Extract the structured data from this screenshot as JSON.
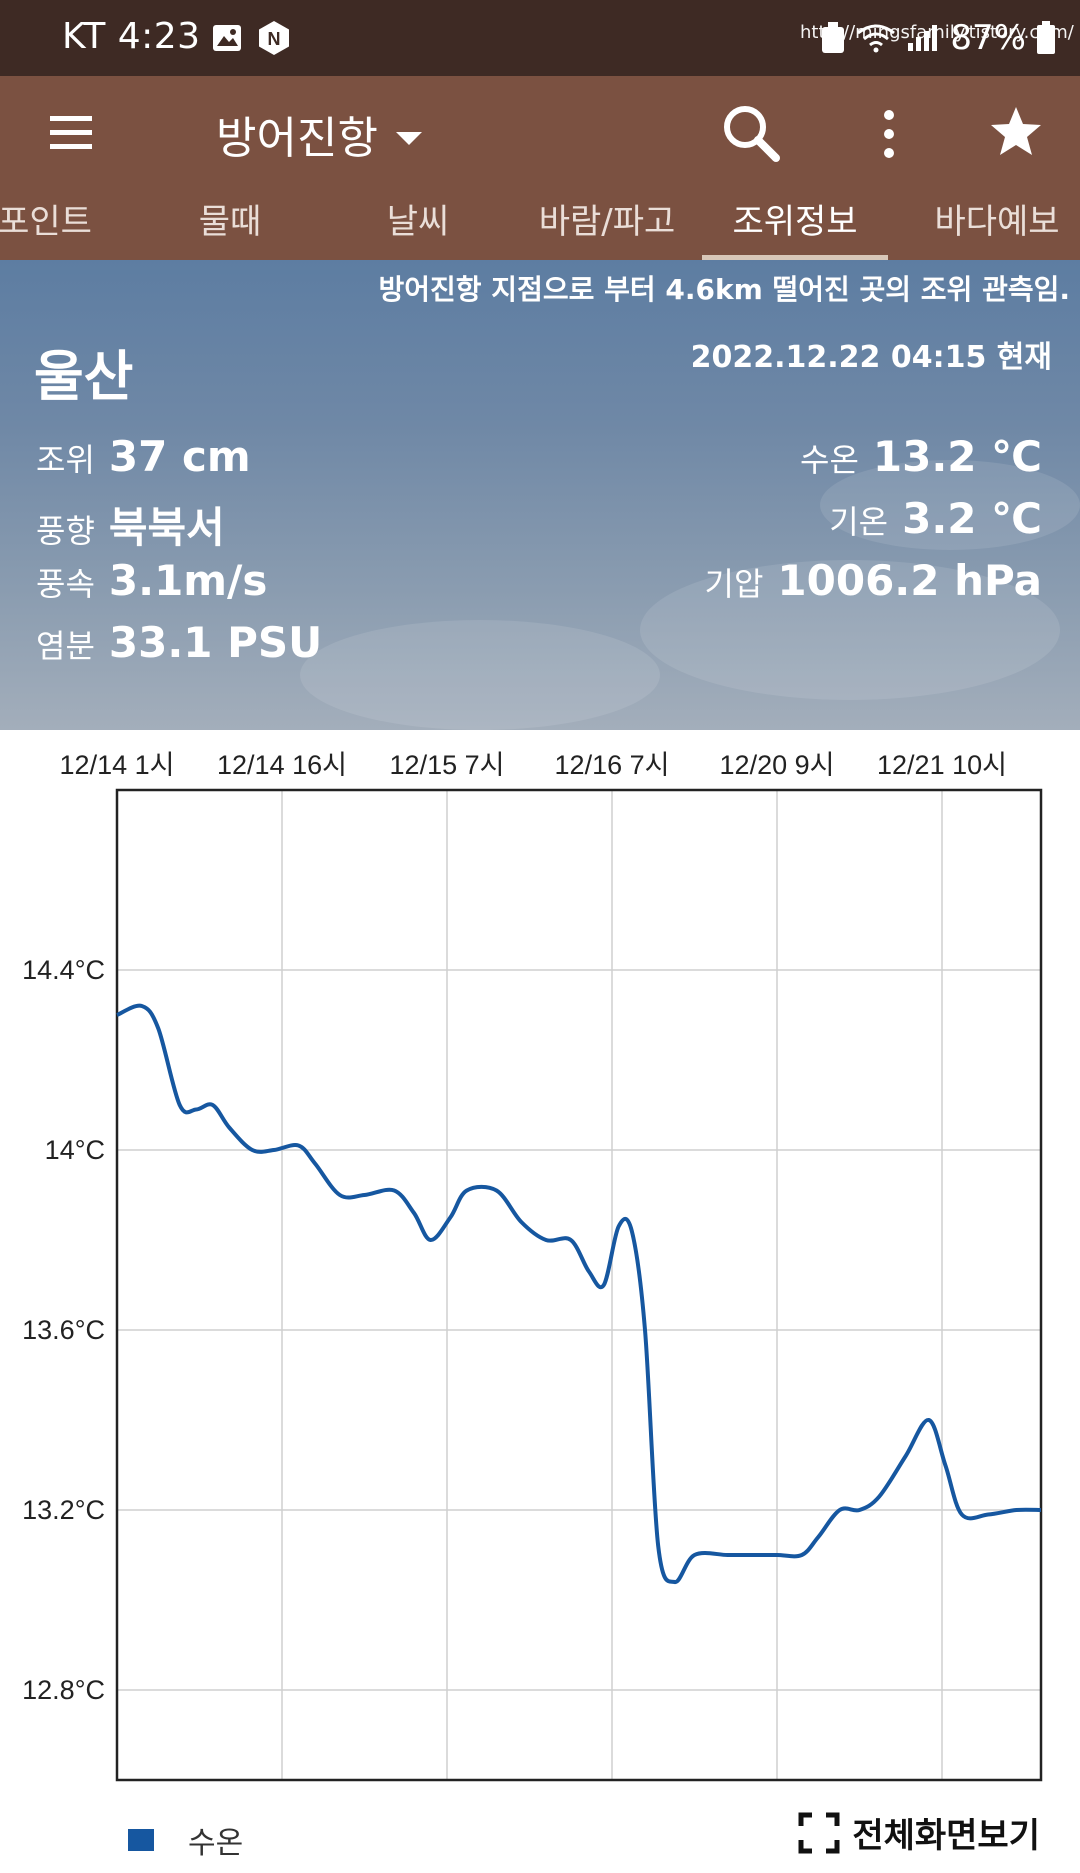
{
  "status_bar": {
    "carrier_time": "KT 4:23",
    "overlay_url": "http://mingsfamily.tistory.com/",
    "battery": "87%"
  },
  "app_bar": {
    "title": "방어진항"
  },
  "tabs": [
    {
      "label": "포인트"
    },
    {
      "label": "물때"
    },
    {
      "label": "날씨"
    },
    {
      "label": "바람/파고"
    },
    {
      "label": "조위정보"
    },
    {
      "label": "바다예보"
    }
  ],
  "info": {
    "notice": "방어진항 지점으로 부터 4.6km 떨어진 곳의 조위 관측임.",
    "station": "울산",
    "updated": "2022.12.22 04:15 현재",
    "tide": {
      "label": "조위",
      "value": "37 cm"
    },
    "wind_dir": {
      "label": "풍향",
      "value": "북북서"
    },
    "wind_speed": {
      "label": "풍속",
      "value": "3.1m/s"
    },
    "salinity": {
      "label": "염분",
      "value": "33.1 PSU"
    },
    "water_temp": {
      "label": "수온",
      "value": "13.2 ℃"
    },
    "air_temp": {
      "label": "기온",
      "value": "3.2 ℃"
    },
    "pressure": {
      "label": "기압",
      "value": "1006.2 hPa"
    }
  },
  "chart_data": {
    "type": "line",
    "x_tick_labels": [
      "12/14 1시",
      "12/14 16시",
      "12/15 7시",
      "12/16 7시",
      "12/20 9시",
      "12/21 10시"
    ],
    "y_tick_labels": [
      "14.4°C",
      "14°C",
      "13.6°C",
      "13.2°C",
      "12.8°C"
    ],
    "y_ticks": [
      14.4,
      14.0,
      13.6,
      13.2,
      12.8
    ],
    "ylim": [
      12.6,
      14.8
    ],
    "x_range": [
      0,
      5.6
    ],
    "grid": true,
    "legend_position": "bottom-left",
    "series": [
      {
        "name": "수온",
        "color": "#1657a0",
        "points": [
          [
            0.0,
            14.3
          ],
          [
            0.15,
            14.32
          ],
          [
            0.25,
            14.27
          ],
          [
            0.38,
            14.1
          ],
          [
            0.48,
            14.09
          ],
          [
            0.58,
            14.1
          ],
          [
            0.68,
            14.05
          ],
          [
            0.82,
            14.0
          ],
          [
            0.95,
            14.0
          ],
          [
            1.1,
            14.01
          ],
          [
            1.2,
            13.97
          ],
          [
            1.35,
            13.9
          ],
          [
            1.5,
            13.9
          ],
          [
            1.68,
            13.91
          ],
          [
            1.8,
            13.86
          ],
          [
            1.9,
            13.8
          ],
          [
            2.02,
            13.85
          ],
          [
            2.12,
            13.91
          ],
          [
            2.3,
            13.91
          ],
          [
            2.45,
            13.84
          ],
          [
            2.6,
            13.8
          ],
          [
            2.75,
            13.8
          ],
          [
            2.86,
            13.73
          ],
          [
            2.95,
            13.7
          ],
          [
            3.04,
            13.83
          ],
          [
            3.12,
            13.82
          ],
          [
            3.2,
            13.6
          ],
          [
            3.28,
            13.12
          ],
          [
            3.38,
            13.04
          ],
          [
            3.5,
            13.1
          ],
          [
            3.7,
            13.1
          ],
          [
            3.85,
            13.1
          ],
          [
            4.0,
            13.1
          ],
          [
            4.15,
            13.1
          ],
          [
            4.25,
            13.14
          ],
          [
            4.38,
            13.2
          ],
          [
            4.5,
            13.2
          ],
          [
            4.62,
            13.23
          ],
          [
            4.78,
            13.32
          ],
          [
            4.92,
            13.4
          ],
          [
            5.02,
            13.3
          ],
          [
            5.12,
            13.19
          ],
          [
            5.28,
            13.19
          ],
          [
            5.45,
            13.2
          ],
          [
            5.6,
            13.2
          ]
        ]
      }
    ]
  },
  "footer": {
    "legend_label": "수온",
    "fullscreen_label": "전체화면보기"
  }
}
